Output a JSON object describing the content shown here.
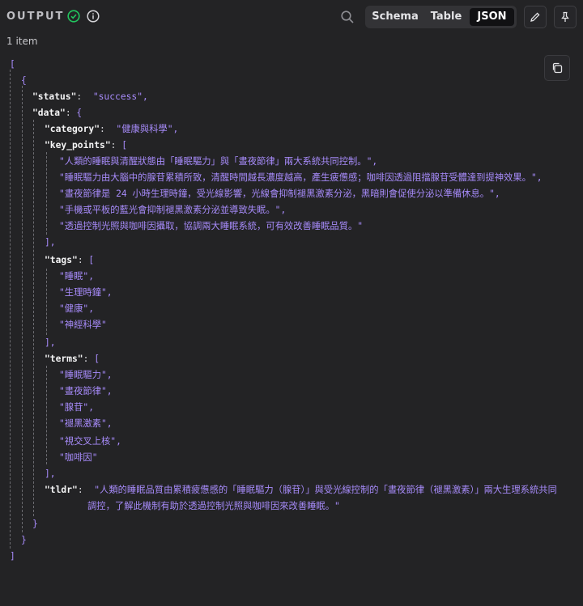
{
  "header": {
    "title": "OUTPUT",
    "tabs": [
      "Schema",
      "Table",
      "JSON"
    ],
    "active_tab": "JSON",
    "status_color": "#22c55e"
  },
  "result_count": "1 item",
  "json": {
    "status": "\"success\"",
    "category": "\"健康與科學\"",
    "key_points": [
      "\"人類的睡眠與清醒狀態由「睡眠驅力」與「晝夜節律」兩大系統共同控制。\"",
      "\"睡眠驅力由大腦中的腺苷累積所致，清醒時間越長濃度越高，產生疲憊感；咖啡因透過阻擋腺苷受體達到提神效果。\"",
      "\"晝夜節律是 24 小時生理時鐘，受光線影響，光線會抑制褪黑激素分泌，黑暗則會促使分泌以準備休息。\"",
      "\"手機或平板的藍光會抑制褪黑激素分泌並導致失眠。\"",
      "\"透過控制光照與咖啡因攝取，協調兩大睡眠系統，可有效改善睡眠品質。\""
    ],
    "tags": [
      "\"睡眠\"",
      "\"生理時鐘\"",
      "\"健康\"",
      "\"神經科學\""
    ],
    "terms": [
      "\"睡眠驅力\"",
      "\"晝夜節律\"",
      "\"腺苷\"",
      "\"褪黑激素\"",
      "\"視交叉上核\"",
      "\"咖啡因\""
    ],
    "tldr_line1": "\"人類的睡眠品質由累積疲憊感的「睡眠驅力（腺苷）」與受光線控制的「晝夜節律（褪黑激素）」兩大生理系統共同",
    "tldr_line2": "調控，了解此機制有助於透過控制光照與咖啡因來改善睡眠。\""
  }
}
